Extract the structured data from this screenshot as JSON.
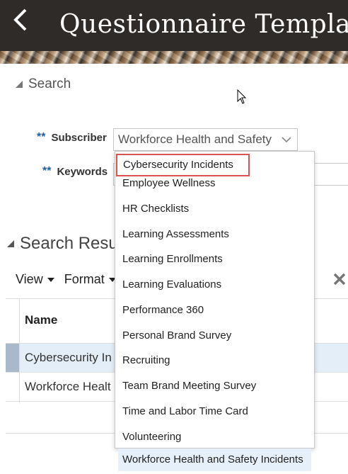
{
  "header": {
    "title": "Questionnaire Templates"
  },
  "search": {
    "section_label": "Search",
    "subscriber_label": "Subscriber",
    "subscriber_required": "**",
    "subscriber_value": "Workforce Health and Safety",
    "keywords_label": "Keywords",
    "keywords_required": "**"
  },
  "results": {
    "section_label": "Search Resul",
    "toolbar": {
      "view": "View",
      "format": "Format"
    },
    "columns": {
      "name": "Name"
    },
    "rows": [
      {
        "name": "Cybersecurity In",
        "selected": true
      },
      {
        "name": "Workforce Healt",
        "selected": false
      }
    ]
  },
  "dropdown": {
    "options": [
      "Cybersecurity Incidents",
      "Employee Wellness",
      "HR Checklists",
      "Learning Assessments",
      "Learning Enrollments",
      "Learning Evaluations",
      "Performance 360",
      "Personal Brand Survey",
      "Recruiting",
      "Team Brand Meeting Survey",
      "Time and Labor Time Card",
      "Volunteering",
      "Workforce Health and Safety Incidents"
    ],
    "highlighted": "Cybersecurity Incidents",
    "hovered": "Workforce Health and Safety Incidents"
  },
  "colors": {
    "header_bg": "#2e2b28",
    "required": "#1a5fa8",
    "highlight_border": "#d9534f",
    "hover_bg": "#e6f0fa"
  }
}
